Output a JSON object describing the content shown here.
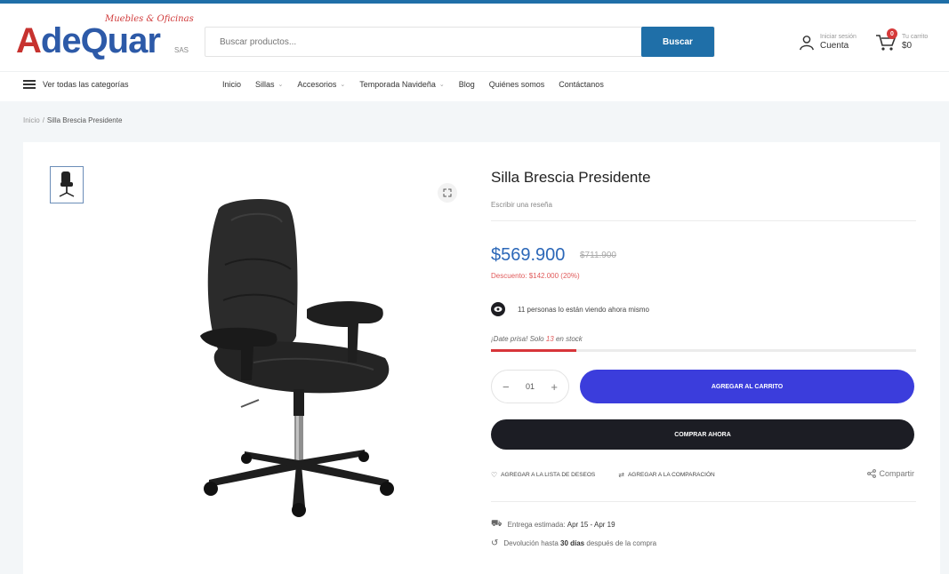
{
  "header": {
    "logo_tagline": "Muebles & Oficinas",
    "logo_text_accent": "A",
    "logo_text_rest": "deQuar",
    "logo_suffix": "SAS",
    "search_placeholder": "Buscar productos...",
    "search_button": "Buscar",
    "account_small": "Iniciar sesión",
    "account_label": "Cuenta",
    "cart_small": "Tu carrito",
    "cart_total": "$0",
    "cart_count": "0"
  },
  "nav": {
    "all_categories": "Ver todas las categorías",
    "items": [
      {
        "label": "Inicio",
        "has_dropdown": false
      },
      {
        "label": "Sillas",
        "has_dropdown": true
      },
      {
        "label": "Accesorios",
        "has_dropdown": true
      },
      {
        "label": "Temporada Navideña",
        "has_dropdown": true
      },
      {
        "label": "Blog",
        "has_dropdown": false
      },
      {
        "label": "Quiénes somos",
        "has_dropdown": false
      },
      {
        "label": "Contáctanos",
        "has_dropdown": false
      }
    ]
  },
  "breadcrumb": {
    "home": "Inicio",
    "separator": "/",
    "current": "Silla Brescia Presidente"
  },
  "product": {
    "title": "Silla Brescia Presidente",
    "review_link": "Escribir una reseña",
    "price": "$569.900",
    "old_price": "$711.900",
    "discount": "Descuento: $142.000 (20%)",
    "viewing": "11 personas lo están viendo ahora mismo",
    "hurry_prefix": "¡Date prisa! Solo",
    "hurry_count": "13",
    "hurry_suffix": "en stock",
    "stock_fraction": 0.2,
    "quantity": "01",
    "qty_minus": "−",
    "qty_plus": "+",
    "add_to_cart": "AGREGAR AL CARRITO",
    "buy_now": "COMPRAR AHORA",
    "wishlist": "AGREGAR A LA LISTA DE DESEOS",
    "compare": "AGREGAR A LA COMPARACIÓN",
    "share": "Compartir",
    "delivery_label": "Entrega estimada:",
    "delivery_value": "Apr 15 - Apr 19",
    "returns_prefix": "Devolución hasta",
    "returns_bold": "30 días",
    "returns_suffix": "después de la compra"
  },
  "icons": {
    "account": "user-icon",
    "cart": "cart-icon",
    "menu": "hamburger-icon",
    "zoom": "expand-icon",
    "eye": "eye-icon",
    "wishlist": "heart-icon",
    "compare": "compare-icon",
    "share": "share-icon",
    "delivery": "truck-icon",
    "returns": "return-icon"
  },
  "colors": {
    "brand_blue": "#1f6fa8",
    "price_blue": "#2b67b8",
    "add_cart": "#3b3ddc",
    "buy_now": "#1c1d24",
    "accent_red": "#d7353a"
  }
}
